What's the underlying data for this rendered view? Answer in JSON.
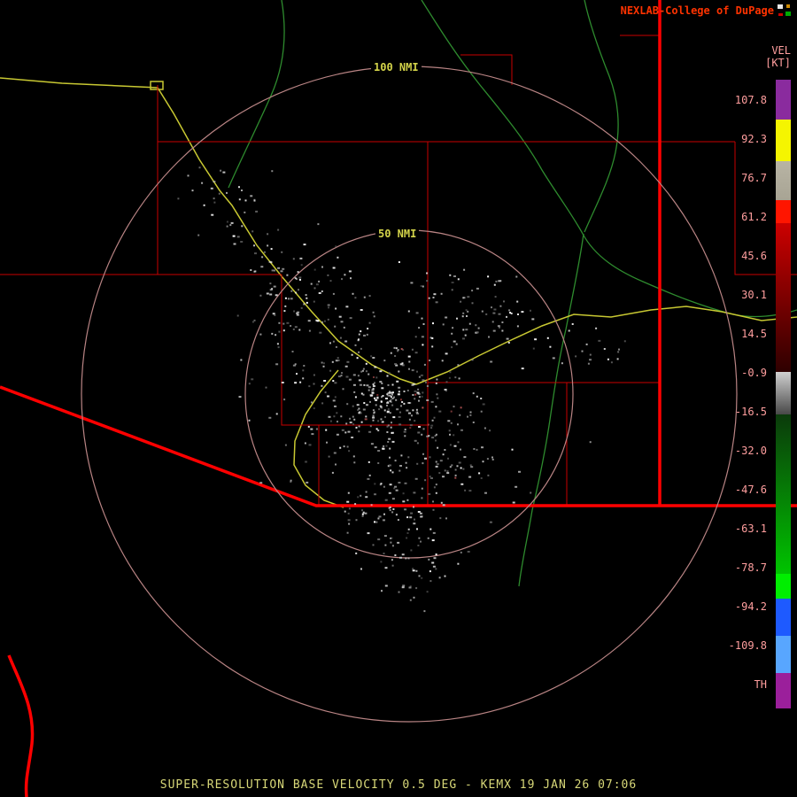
{
  "header": {
    "attribution": "NEXLAB-College of DuPage",
    "attribution_color": "#ff3300"
  },
  "colorbar": {
    "title": "VEL",
    "units": "[KT]",
    "label_color": "#ff9e9e",
    "ticks": [
      "107.8",
      "92.3",
      "76.7",
      "61.2",
      "45.6",
      "30.1",
      "14.5",
      "-0.9",
      "-16.5",
      "-32.0",
      "-47.6",
      "-63.1",
      "-78.7",
      "-94.2",
      "-109.8",
      "TH"
    ],
    "segments": [
      {
        "name": "purple-high",
        "top": "#8a2b9e",
        "bottom": "#8a2b9e",
        "h": 0.0634
      },
      {
        "name": "yellow",
        "top": "#f5f500",
        "bottom": "#f5f500",
        "h": 0.0662
      },
      {
        "name": "tan-gray",
        "top": "#b8b4a4",
        "bottom": "#a8a494",
        "h": 0.062
      },
      {
        "name": "bright-red",
        "top": "#ff1500",
        "bottom": "#ff1500",
        "h": 0.0366
      },
      {
        "name": "dark-red-ramp",
        "top": "#cc0000",
        "bottom": "#2e0000",
        "h": 0.2366
      },
      {
        "name": "gray-zero",
        "top": "#d0d0d0",
        "bottom": "#484848",
        "h": 0.0676
      },
      {
        "name": "green-ramp",
        "top": "#0b3a0b",
        "bottom": "#00c400",
        "h": 0.2535
      },
      {
        "name": "bright-green",
        "top": "#00ee00",
        "bottom": "#00ee00",
        "h": 0.0394
      },
      {
        "name": "blue",
        "top": "#1e5aff",
        "bottom": "#1e5aff",
        "h": 0.0592
      },
      {
        "name": "light-blue",
        "top": "#58a6ff",
        "bottom": "#58a6ff",
        "h": 0.0592
      },
      {
        "name": "purple-low",
        "top": "#9b1f9b",
        "bottom": "#9b1f9b",
        "h": 0.0563
      }
    ]
  },
  "map": {
    "rings": [
      {
        "label": "100 NMI"
      },
      {
        "label": "50 NMI"
      }
    ],
    "colors": {
      "ring": "#b98484",
      "ring_label": "#d4d44a",
      "county": "#c80000",
      "state_border": "#ff0000",
      "highway": "#c8c832",
      "river": "#2e8b2e",
      "echo_light": "#e8e8e8"
    }
  },
  "footer": {
    "caption": "SUPER-RESOLUTION BASE VELOCITY 0.5 DEG - KEMX 19 JAN 26 07:06",
    "caption_color": "#d8d878"
  }
}
